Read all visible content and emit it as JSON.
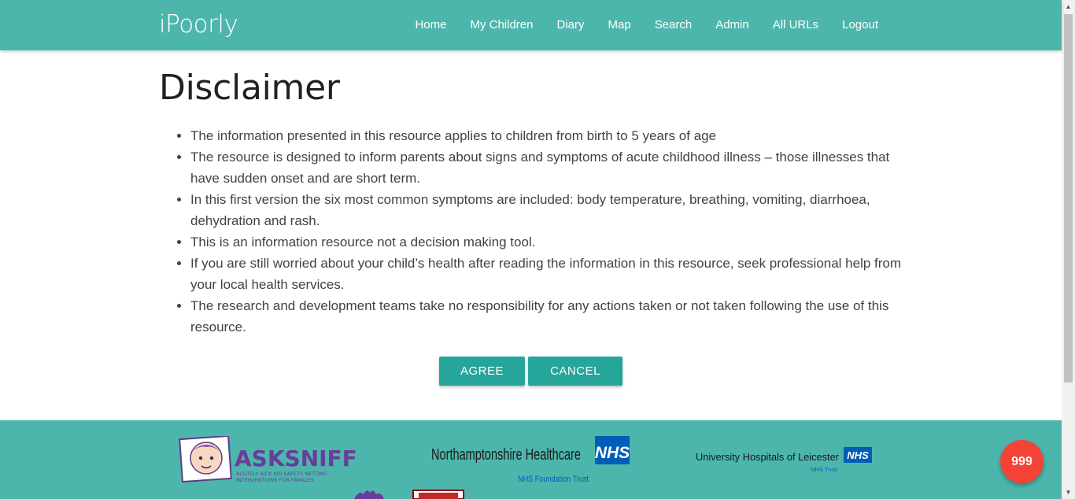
{
  "brand": "iPoorly",
  "nav": [
    "Home",
    "My Children",
    "Diary",
    "Map",
    "Search",
    "Admin",
    "All URLs",
    "Logout"
  ],
  "page_title": "Disclaimer",
  "disclaimer_items": [
    "The information presented in this resource applies to children from birth to 5 years of age",
    "The resource is designed to inform parents about signs and symptoms of acute childhood illness – those illnesses that have sudden onset and are short term.",
    "In this first version the six most common symptoms are included: body temperature, breathing, vomiting, diarrhoea, dehydration and rash.",
    "This is an information resource not a decision making tool.",
    "If you are still worried about your child’s health after reading the information in this resource, seek professional help from your local health services.",
    "The research and development teams take no responsibility for any actions taken or not taken following the use of this resource."
  ],
  "buttons": {
    "agree": "AGREE",
    "cancel": "CANCEL"
  },
  "footer_logos": {
    "asksniff_name": "ASKSNIFF",
    "asksniff_tagline_1": "ACUTELY SICK KID SAFETY NETTING",
    "asksniff_tagline_2": "INTERVENTIONS FOR FAMILIES",
    "nhft_name": "Northamptonshire Healthcare",
    "nhft_sub": "NHS Foundation Trust",
    "uhl_name": "University Hospitals of Leicester",
    "uhl_sub": "NHS Trust",
    "nhs_badge": "NHS"
  },
  "emergency_button": "999",
  "colors": {
    "navbar": "#4db6ac",
    "button": "#26a69a",
    "emergency": "#f44336",
    "asksniff_purple": "#6a3d9a",
    "nhs_blue": "#005eb8"
  }
}
